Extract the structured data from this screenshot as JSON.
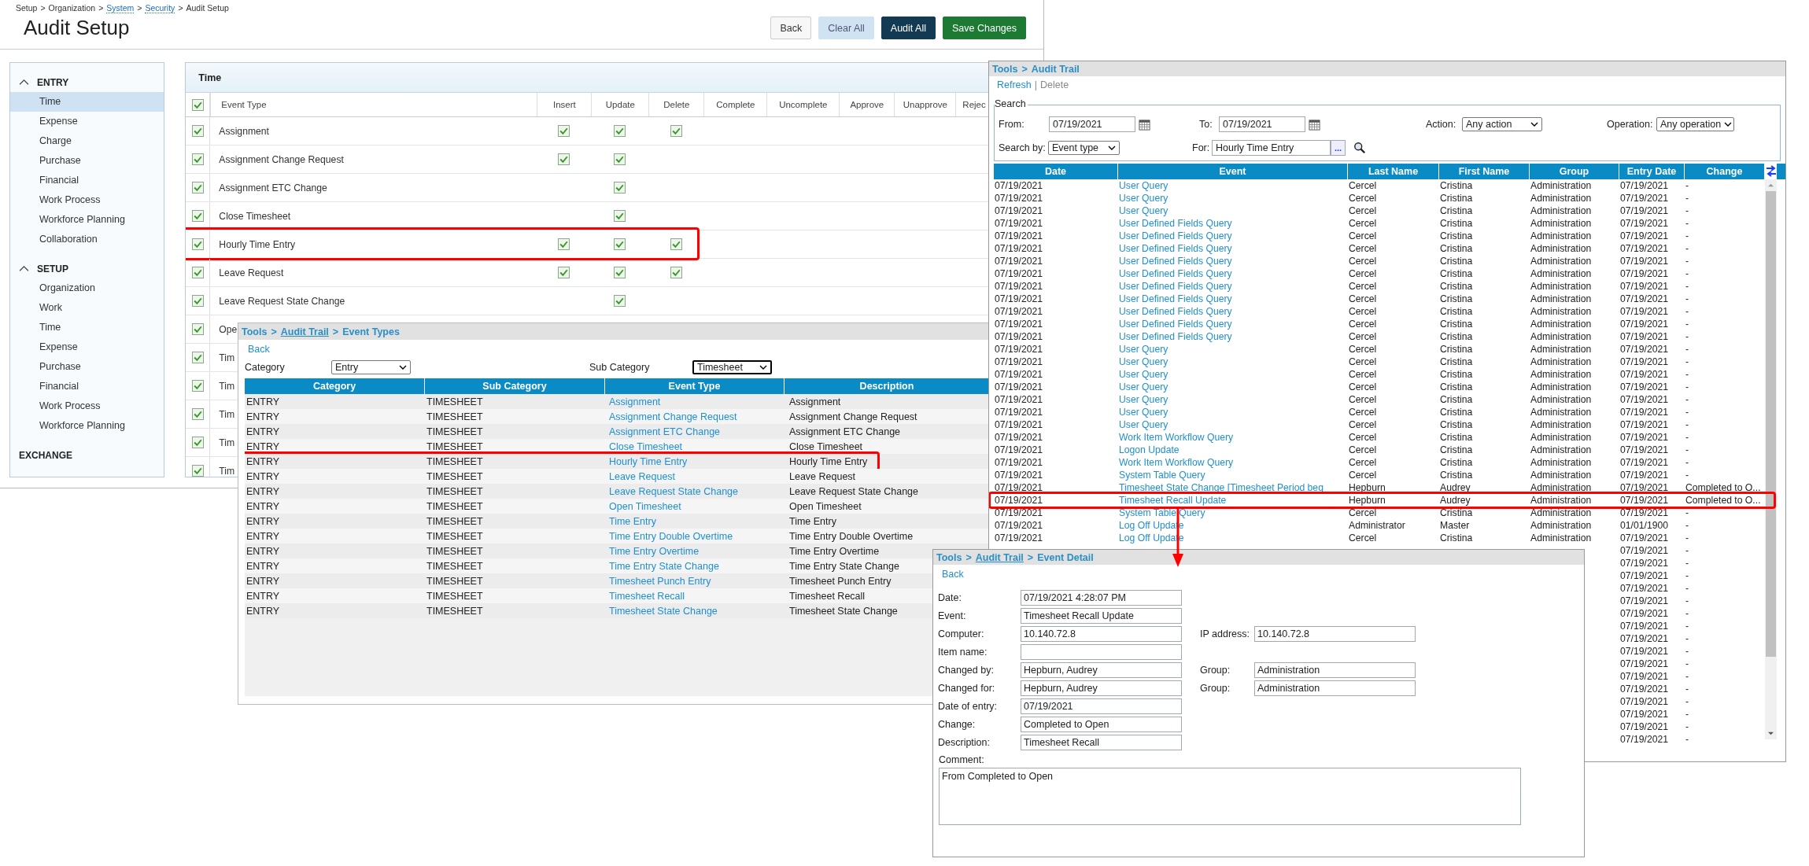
{
  "audit_setup": {
    "breadcrumb": [
      {
        "text": "Setup",
        "link": false
      },
      {
        "text": ">",
        "link": false
      },
      {
        "text": "Organization",
        "link": false
      },
      {
        "text": ">",
        "link": false
      },
      {
        "text": "System",
        "link": true
      },
      {
        "text": ">",
        "link": false
      },
      {
        "text": "Security",
        "link": true
      },
      {
        "text": ">",
        "link": false
      },
      {
        "text": "Audit Setup",
        "link": false
      }
    ],
    "title": "Audit Setup",
    "buttons": [
      {
        "label": "Back",
        "kind": "default"
      },
      {
        "label": "Clear All",
        "kind": "light"
      },
      {
        "label": "Audit All",
        "kind": "dark"
      },
      {
        "label": "Save Changes",
        "kind": "primary"
      }
    ],
    "sidebar": [
      {
        "label": "ENTRY",
        "expanded": true,
        "children": [
          {
            "label": "Time",
            "selected": true
          },
          {
            "label": "Expense",
            "selected": false
          },
          {
            "label": "Charge",
            "selected": false
          },
          {
            "label": "Purchase",
            "selected": false
          },
          {
            "label": "Financial",
            "selected": false
          },
          {
            "label": "Work Process",
            "selected": false
          },
          {
            "label": "Workforce Planning",
            "selected": false
          },
          {
            "label": "Collaboration",
            "selected": false
          }
        ]
      },
      {
        "label": "SETUP",
        "expanded": true,
        "children": [
          {
            "label": "Organization",
            "selected": false
          },
          {
            "label": "Work",
            "selected": false
          },
          {
            "label": "Time",
            "selected": false
          },
          {
            "label": "Expense",
            "selected": false
          },
          {
            "label": "Purchase",
            "selected": false
          },
          {
            "label": "Financial",
            "selected": false
          },
          {
            "label": "Work Process",
            "selected": false
          },
          {
            "label": "Workforce Planning",
            "selected": false
          }
        ]
      },
      {
        "label": "EXCHANGE"
      }
    ],
    "panel": {
      "title": "Time",
      "header_checked": true,
      "columns": [
        "Event Type",
        "Insert",
        "Update",
        "Delete",
        "Complete",
        "Uncomplete",
        "Approve",
        "Unapprove",
        "Rejec"
      ],
      "rows": [
        {
          "event_type": "Assignment",
          "checked": true,
          "insert": true,
          "update": true,
          "delete": true,
          "highlighted": false
        },
        {
          "event_type": "Assignment Change Request",
          "checked": true,
          "insert": true,
          "update": true,
          "delete": false,
          "highlighted": false
        },
        {
          "event_type": "Assignment ETC Change",
          "checked": true,
          "insert": false,
          "update": true,
          "delete": false,
          "highlighted": false
        },
        {
          "event_type": "Close Timesheet",
          "checked": true,
          "insert": false,
          "update": true,
          "delete": false,
          "highlighted": false
        },
        {
          "event_type": "Hourly Time Entry",
          "checked": true,
          "insert": true,
          "update": true,
          "delete": true,
          "highlighted": true
        },
        {
          "event_type": "Leave Request",
          "checked": true,
          "insert": true,
          "update": true,
          "delete": true,
          "highlighted": false
        },
        {
          "event_type": "Leave Request State Change",
          "checked": true,
          "insert": false,
          "update": true,
          "delete": false,
          "highlighted": false
        },
        {
          "event_type": "Ope",
          "checked": true,
          "highlighted": false
        },
        {
          "event_type": "Tim",
          "checked": true,
          "highlighted": false
        },
        {
          "event_type": "Tim",
          "checked": true,
          "highlighted": false
        },
        {
          "event_type": "Tim",
          "checked": true,
          "highlighted": false
        },
        {
          "event_type": "Tim",
          "checked": true,
          "highlighted": false
        },
        {
          "event_type": "Tim",
          "checked": true,
          "highlighted": false
        }
      ]
    }
  },
  "event_types": {
    "title": [
      {
        "text": "Tools",
        "link": false
      },
      {
        "text": ">",
        "link": false
      },
      {
        "text": "Audit Trail",
        "link": true
      },
      {
        "text": ">",
        "link": false
      },
      {
        "text": "Event Types",
        "link": false
      }
    ],
    "back": "Back",
    "category_label": "Category",
    "category_value": "Entry",
    "sub_category_label": "Sub Category",
    "sub_category_value": "Timesheet",
    "columns": [
      "Category",
      "Sub Category",
      "Event Type",
      "Description"
    ],
    "rows": [
      {
        "category": "ENTRY",
        "sub_category": "TIMESHEET",
        "event_type": "Assignment",
        "description": "Assignment",
        "highlighted": false
      },
      {
        "category": "ENTRY",
        "sub_category": "TIMESHEET",
        "event_type": "Assignment Change Request",
        "description": "Assignment Change Request",
        "highlighted": false
      },
      {
        "category": "ENTRY",
        "sub_category": "TIMESHEET",
        "event_type": "Assignment ETC Change",
        "description": "Assignment ETC Change",
        "highlighted": false
      },
      {
        "category": "ENTRY",
        "sub_category": "TIMESHEET",
        "event_type": "Close Timesheet",
        "description": "Close Timesheet",
        "highlighted": false
      },
      {
        "category": "ENTRY",
        "sub_category": "TIMESHEET",
        "event_type": "Hourly Time Entry",
        "description": "Hourly Time Entry",
        "highlighted": true
      },
      {
        "category": "ENTRY",
        "sub_category": "TIMESHEET",
        "event_type": "Leave Request",
        "description": "Leave Request",
        "highlighted": false
      },
      {
        "category": "ENTRY",
        "sub_category": "TIMESHEET",
        "event_type": "Leave Request State Change",
        "description": "Leave Request State Change",
        "highlighted": false
      },
      {
        "category": "ENTRY",
        "sub_category": "TIMESHEET",
        "event_type": "Open Timesheet",
        "description": "Open Timesheet",
        "highlighted": false
      },
      {
        "category": "ENTRY",
        "sub_category": "TIMESHEET",
        "event_type": "Time Entry",
        "description": "Time Entry",
        "highlighted": false
      },
      {
        "category": "ENTRY",
        "sub_category": "TIMESHEET",
        "event_type": "Time Entry Double Overtime",
        "description": "Time Entry Double Overtime",
        "highlighted": false
      },
      {
        "category": "ENTRY",
        "sub_category": "TIMESHEET",
        "event_type": "Time Entry Overtime",
        "description": "Time Entry Overtime",
        "highlighted": false
      },
      {
        "category": "ENTRY",
        "sub_category": "TIMESHEET",
        "event_type": "Time Entry State Change",
        "description": "Time Entry State Change",
        "highlighted": false
      },
      {
        "category": "ENTRY",
        "sub_category": "TIMESHEET",
        "event_type": "Timesheet Punch Entry",
        "description": "Timesheet Punch Entry",
        "highlighted": false
      },
      {
        "category": "ENTRY",
        "sub_category": "TIMESHEET",
        "event_type": "Timesheet Recall",
        "description": "Timesheet Recall",
        "highlighted": false
      },
      {
        "category": "ENTRY",
        "sub_category": "TIMESHEET",
        "event_type": "Timesheet State Change",
        "description": "Timesheet State Change",
        "highlighted": false
      }
    ]
  },
  "audit_trail": {
    "title": [
      {
        "text": "Tools",
        "link": false
      },
      {
        "text": ">",
        "link": false
      },
      {
        "text": "Audit Trail",
        "link": false
      }
    ],
    "actions": [
      {
        "label": "Refresh",
        "disabled": false
      },
      {
        "label": "Delete",
        "disabled": true
      }
    ],
    "actions_separator": "|",
    "search": {
      "legend": "Search",
      "from_label": "From:",
      "from_value": "07/19/2021",
      "to_label": "To:",
      "to_value": "07/19/2021",
      "action_label": "Action:",
      "action_value": "Any action",
      "operation_label": "Operation:",
      "operation_value": "Any operation",
      "search_by_label": "Search by:",
      "search_by_value": "Event type",
      "for_label": "For:",
      "for_value": "Hourly Time Entry",
      "browse_button": "..."
    },
    "columns": [
      "Date",
      "Event",
      "Last Name",
      "First Name",
      "Group",
      "Entry Date",
      "Change"
    ],
    "rows": [
      {
        "date": "07/19/2021",
        "event": "User Query",
        "last_name": "Cercel",
        "first_name": "Cristina",
        "group": "Administration",
        "entry_date": "07/19/2021",
        "change": "-",
        "highlighted": false
      },
      {
        "date": "07/19/2021",
        "event": "User Query",
        "last_name": "Cercel",
        "first_name": "Cristina",
        "group": "Administration",
        "entry_date": "07/19/2021",
        "change": "-",
        "highlighted": false
      },
      {
        "date": "07/19/2021",
        "event": "User Query",
        "last_name": "Cercel",
        "first_name": "Cristina",
        "group": "Administration",
        "entry_date": "07/19/2021",
        "change": "-",
        "highlighted": false
      },
      {
        "date": "07/19/2021",
        "event": "User Defined Fields Query",
        "last_name": "Cercel",
        "first_name": "Cristina",
        "group": "Administration",
        "entry_date": "07/19/2021",
        "change": "-",
        "highlighted": false
      },
      {
        "date": "07/19/2021",
        "event": "User Defined Fields Query",
        "last_name": "Cercel",
        "first_name": "Cristina",
        "group": "Administration",
        "entry_date": "07/19/2021",
        "change": "-",
        "highlighted": false
      },
      {
        "date": "07/19/2021",
        "event": "User Defined Fields Query",
        "last_name": "Cercel",
        "first_name": "Cristina",
        "group": "Administration",
        "entry_date": "07/19/2021",
        "change": "-",
        "highlighted": false
      },
      {
        "date": "07/19/2021",
        "event": "User Defined Fields Query",
        "last_name": "Cercel",
        "first_name": "Cristina",
        "group": "Administration",
        "entry_date": "07/19/2021",
        "change": "-",
        "highlighted": false
      },
      {
        "date": "07/19/2021",
        "event": "User Defined Fields Query",
        "last_name": "Cercel",
        "first_name": "Cristina",
        "group": "Administration",
        "entry_date": "07/19/2021",
        "change": "-",
        "highlighted": false
      },
      {
        "date": "07/19/2021",
        "event": "User Defined Fields Query",
        "last_name": "Cercel",
        "first_name": "Cristina",
        "group": "Administration",
        "entry_date": "07/19/2021",
        "change": "-",
        "highlighted": false
      },
      {
        "date": "07/19/2021",
        "event": "User Defined Fields Query",
        "last_name": "Cercel",
        "first_name": "Cristina",
        "group": "Administration",
        "entry_date": "07/19/2021",
        "change": "-",
        "highlighted": false
      },
      {
        "date": "07/19/2021",
        "event": "User Defined Fields Query",
        "last_name": "Cercel",
        "first_name": "Cristina",
        "group": "Administration",
        "entry_date": "07/19/2021",
        "change": "-",
        "highlighted": false
      },
      {
        "date": "07/19/2021",
        "event": "User Defined Fields Query",
        "last_name": "Cercel",
        "first_name": "Cristina",
        "group": "Administration",
        "entry_date": "07/19/2021",
        "change": "-",
        "highlighted": false
      },
      {
        "date": "07/19/2021",
        "event": "User Defined Fields Query",
        "last_name": "Cercel",
        "first_name": "Cristina",
        "group": "Administration",
        "entry_date": "07/19/2021",
        "change": "-",
        "highlighted": false
      },
      {
        "date": "07/19/2021",
        "event": "User Query",
        "last_name": "Cercel",
        "first_name": "Cristina",
        "group": "Administration",
        "entry_date": "07/19/2021",
        "change": "-",
        "highlighted": false
      },
      {
        "date": "07/19/2021",
        "event": "User Query",
        "last_name": "Cercel",
        "first_name": "Cristina",
        "group": "Administration",
        "entry_date": "07/19/2021",
        "change": "-",
        "highlighted": false
      },
      {
        "date": "07/19/2021",
        "event": "User Query",
        "last_name": "Cercel",
        "first_name": "Cristina",
        "group": "Administration",
        "entry_date": "07/19/2021",
        "change": "-",
        "highlighted": false
      },
      {
        "date": "07/19/2021",
        "event": "User Query",
        "last_name": "Cercel",
        "first_name": "Cristina",
        "group": "Administration",
        "entry_date": "07/19/2021",
        "change": "-",
        "highlighted": false
      },
      {
        "date": "07/19/2021",
        "event": "User Query",
        "last_name": "Cercel",
        "first_name": "Cristina",
        "group": "Administration",
        "entry_date": "07/19/2021",
        "change": "-",
        "highlighted": false
      },
      {
        "date": "07/19/2021",
        "event": "User Query",
        "last_name": "Cercel",
        "first_name": "Cristina",
        "group": "Administration",
        "entry_date": "07/19/2021",
        "change": "-",
        "highlighted": false
      },
      {
        "date": "07/19/2021",
        "event": "User Query",
        "last_name": "Cercel",
        "first_name": "Cristina",
        "group": "Administration",
        "entry_date": "07/19/2021",
        "change": "-",
        "highlighted": false
      },
      {
        "date": "07/19/2021",
        "event": "Work Item Workflow Query",
        "last_name": "Cercel",
        "first_name": "Cristina",
        "group": "Administration",
        "entry_date": "07/19/2021",
        "change": "-",
        "highlighted": false
      },
      {
        "date": "07/19/2021",
        "event": "Logon Update",
        "last_name": "Cercel",
        "first_name": "Cristina",
        "group": "Administration",
        "entry_date": "07/19/2021",
        "change": "-",
        "highlighted": false
      },
      {
        "date": "07/19/2021",
        "event": "Work Item Workflow Query",
        "last_name": "Cercel",
        "first_name": "Cristina",
        "group": "Administration",
        "entry_date": "07/19/2021",
        "change": "-",
        "highlighted": false
      },
      {
        "date": "07/19/2021",
        "event": "System Table Query",
        "last_name": "Cercel",
        "first_name": "Cristina",
        "group": "Administration",
        "entry_date": "07/19/2021",
        "change": "-",
        "highlighted": false
      },
      {
        "date": "07/19/2021",
        "event": "Timesheet State Change [Timesheet Period beg",
        "last_name": "Hepburn",
        "first_name": "Audrey",
        "group": "Administration",
        "entry_date": "07/19/2021",
        "change": "Completed to O...",
        "highlighted": false
      },
      {
        "date": "07/19/2021",
        "event": "Timesheet Recall Update",
        "last_name": "Hepburn",
        "first_name": "Audrey",
        "group": "Administration",
        "entry_date": "07/19/2021",
        "change": "Completed to O...",
        "highlighted": true
      },
      {
        "date": "07/19/2021",
        "event": "System Table Query",
        "last_name": "Cercel",
        "first_name": "Cristina",
        "group": "Administration",
        "entry_date": "07/19/2021",
        "change": "-",
        "highlighted": false
      },
      {
        "date": "07/19/2021",
        "event": "Log Off Update",
        "last_name": "Administrator",
        "first_name": "Master",
        "group": "Administration",
        "entry_date": "01/01/1900",
        "change": "-",
        "highlighted": false
      },
      {
        "date": "07/19/2021",
        "event": "Log Off Update",
        "last_name": "Cercel",
        "first_name": "Cristina",
        "group": "Administration",
        "entry_date": "07/19/2021",
        "change": "-",
        "highlighted": false
      },
      {
        "entry_date": "07/19/2021",
        "change": "-",
        "highlighted": false
      },
      {
        "entry_date": "07/19/2021",
        "change": "-",
        "highlighted": false
      },
      {
        "entry_date": "07/19/2021",
        "change": "-",
        "highlighted": false
      },
      {
        "entry_date": "07/19/2021",
        "change": "-",
        "highlighted": false
      },
      {
        "entry_date": "07/19/2021",
        "change": "-",
        "highlighted": false
      },
      {
        "entry_date": "07/19/2021",
        "change": "-",
        "highlighted": false
      },
      {
        "entry_date": "07/19/2021",
        "change": "-",
        "highlighted": false
      },
      {
        "entry_date": "07/19/2021",
        "change": "-",
        "highlighted": false
      },
      {
        "entry_date": "07/19/2021",
        "change": "-",
        "highlighted": false
      },
      {
        "entry_date": "07/19/2021",
        "change": "-",
        "highlighted": false
      },
      {
        "entry_date": "07/19/2021",
        "change": "-",
        "highlighted": false
      },
      {
        "entry_date": "07/19/2021",
        "change": "-",
        "highlighted": false
      },
      {
        "entry_date": "07/19/2021",
        "change": "-",
        "highlighted": false
      },
      {
        "entry_date": "07/19/2021",
        "change": "-",
        "highlighted": false
      },
      {
        "entry_date": "07/19/2021",
        "change": "-",
        "highlighted": false
      },
      {
        "entry_date": "07/19/2021",
        "change": "-",
        "highlighted": false
      }
    ]
  },
  "event_detail": {
    "title": [
      {
        "text": "Tools",
        "link": false
      },
      {
        "text": ">",
        "link": false
      },
      {
        "text": "Audit Trail",
        "link": true
      },
      {
        "text": ">",
        "link": false
      },
      {
        "text": "Event Detail",
        "link": false
      }
    ],
    "back": "Back",
    "fields": [
      {
        "label": "Date:",
        "value": "07/19/2021 4:28:07 PM"
      },
      {
        "label": "Event:",
        "value": "Timesheet Recall Update"
      },
      {
        "label": "Computer:",
        "value": "10.140.72.8",
        "extra_label": "IP address:",
        "extra_value": "10.140.72.8"
      },
      {
        "label": "Item name:"
      },
      {
        "label": "Changed by:",
        "value": "Hepburn, Audrey",
        "extra_label": "Group:",
        "extra_value": "Administration"
      },
      {
        "label": "Changed for:",
        "value": "Hepburn, Audrey",
        "extra_label": "Group:",
        "extra_value": "Administration"
      },
      {
        "label": "Date of entry:",
        "value": "07/19/2021"
      },
      {
        "label": "Change:",
        "value": "Completed to Open"
      },
      {
        "label": "Description:",
        "value": "Timesheet Recall"
      }
    ],
    "comment_label": "Comment:",
    "comment": "From Completed to Open"
  }
}
